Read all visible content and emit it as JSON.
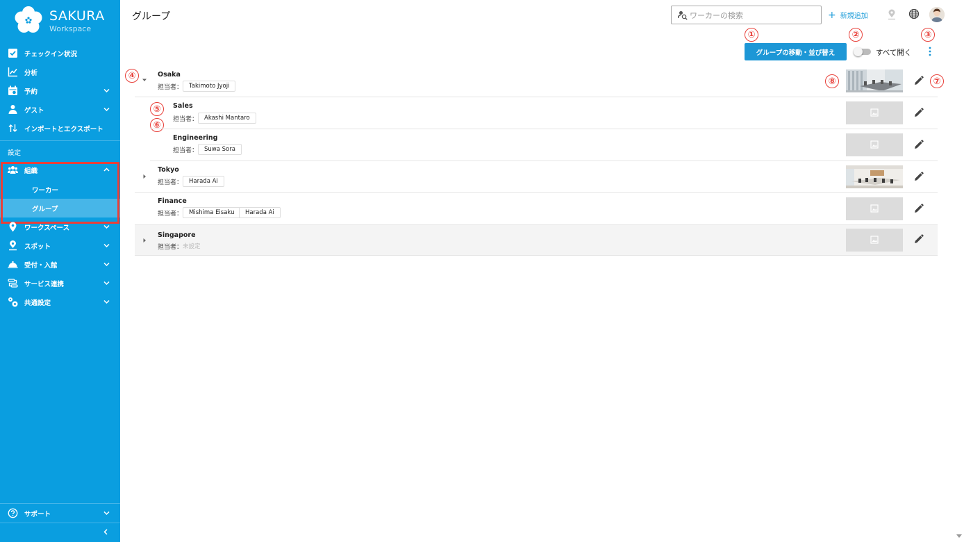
{
  "brand": {
    "name": "SAKURA",
    "sub": "Workspace"
  },
  "sidebar": {
    "items": [
      {
        "label": "チェックイン状況",
        "icon": "checkbox-icon"
      },
      {
        "label": "分析",
        "icon": "chart-line-icon"
      },
      {
        "label": "予約",
        "icon": "calendar-icon"
      },
      {
        "label": "ゲスト",
        "icon": "guest-icon"
      },
      {
        "label": "インポートとエクスポート",
        "icon": "import-export-icon"
      }
    ],
    "section_label": "設定",
    "org": {
      "label": "組織",
      "icon": "people-icon"
    },
    "org_sub": [
      {
        "label": "ワーカー"
      },
      {
        "label": "グループ"
      }
    ],
    "items2": [
      {
        "label": "ワークスペース",
        "icon": "location-pin-icon"
      },
      {
        "label": "スポット",
        "icon": "spot-icon"
      },
      {
        "label": "受付・入館",
        "icon": "reception-bell-icon"
      },
      {
        "label": "サービス連携",
        "icon": "integration-icon"
      },
      {
        "label": "共通設定",
        "icon": "settings-gears-icon"
      }
    ],
    "support": {
      "label": "サポート",
      "icon": "help-circle-icon"
    }
  },
  "header": {
    "title": "グループ",
    "search_placeholder": "ワーカーの検索",
    "add_new": "新規追加"
  },
  "toolbar": {
    "move_sort": "グループの移動・並び替え",
    "expand_all": "すべて開く",
    "expand_all_on": false
  },
  "annotations": [
    "①",
    "②",
    "③",
    "④",
    "⑤",
    "⑥",
    "⑦",
    "⑧"
  ],
  "groups": [
    {
      "name": "Osaka",
      "manager_label": "担当者：",
      "managers": [
        "Takimoto Jyoji"
      ],
      "has_photo": true
    },
    {
      "name": "Sales",
      "manager_label": "担当者：",
      "managers": [
        "Akashi Mantaro"
      ],
      "has_photo": false
    },
    {
      "name": "Engineering",
      "manager_label": "担当者：",
      "managers": [
        "Suwa Sora"
      ],
      "has_photo": false
    },
    {
      "name": "Tokyo",
      "manager_label": "担当者：",
      "managers": [
        "Harada Ai"
      ],
      "has_photo": true
    },
    {
      "name": "Finance",
      "manager_label": "担当者：",
      "managers": [
        "Mishima Eisaku",
        "Harada Ai"
      ],
      "has_photo": false
    },
    {
      "name": "Singapore",
      "manager_label": "担当者：",
      "managers": [],
      "unset_label": "未設定",
      "has_photo": false
    }
  ],
  "colors": {
    "sidebar": "#0a9ee0",
    "accent": "#1d97d6",
    "annotation": "#e8403a"
  }
}
